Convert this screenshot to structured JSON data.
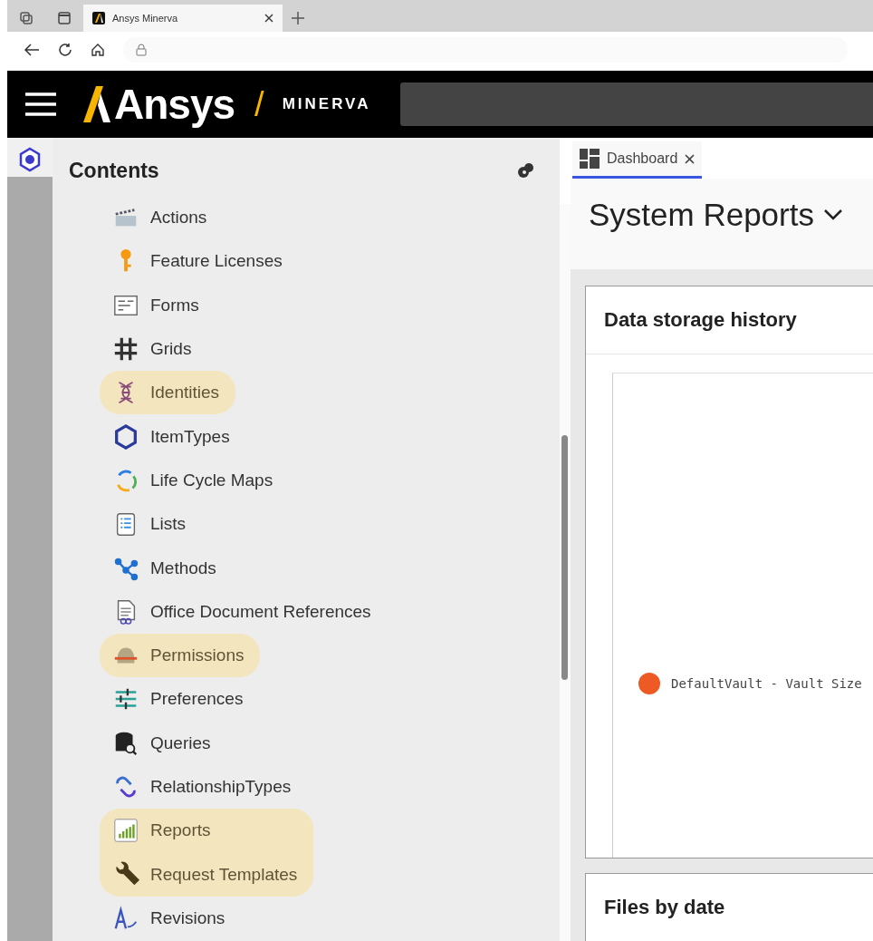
{
  "browser": {
    "tabs": [
      {
        "title": "Ansys Minerva",
        "selected": true
      }
    ]
  },
  "app_header": {
    "brand": "Ansys",
    "slash": "/",
    "product": "MINERVA"
  },
  "contents": {
    "title": "Contents",
    "items": [
      {
        "label": "Actions",
        "highlighted": false
      },
      {
        "label": "Feature Licenses",
        "highlighted": false
      },
      {
        "label": "Forms",
        "highlighted": false
      },
      {
        "label": "Grids",
        "highlighted": false
      },
      {
        "label": "Identities",
        "highlighted": true
      },
      {
        "label": "ItemTypes",
        "highlighted": false
      },
      {
        "label": "Life Cycle Maps",
        "highlighted": false
      },
      {
        "label": "Lists",
        "highlighted": false
      },
      {
        "label": "Methods",
        "highlighted": false
      },
      {
        "label": "Office Document References",
        "highlighted": false
      },
      {
        "label": "Permissions",
        "highlighted": true
      },
      {
        "label": "Preferences",
        "highlighted": false
      },
      {
        "label": "Queries",
        "highlighted": false
      },
      {
        "label": "RelationshipTypes",
        "highlighted": false
      },
      {
        "label": "Reports",
        "highlighted": true
      },
      {
        "label": "Request Templates",
        "highlighted": true
      },
      {
        "label": "Revisions",
        "highlighted": false
      }
    ]
  },
  "workspace": {
    "tabs": [
      {
        "label": "Dashboard",
        "selected": true
      }
    ],
    "heading": "System Reports",
    "cards": [
      {
        "title": "Data storage history",
        "legend": [
          {
            "label": "DefaultVault - Vault Size",
            "color": "#ee5a24"
          }
        ]
      },
      {
        "title": "Files by date"
      }
    ]
  }
}
